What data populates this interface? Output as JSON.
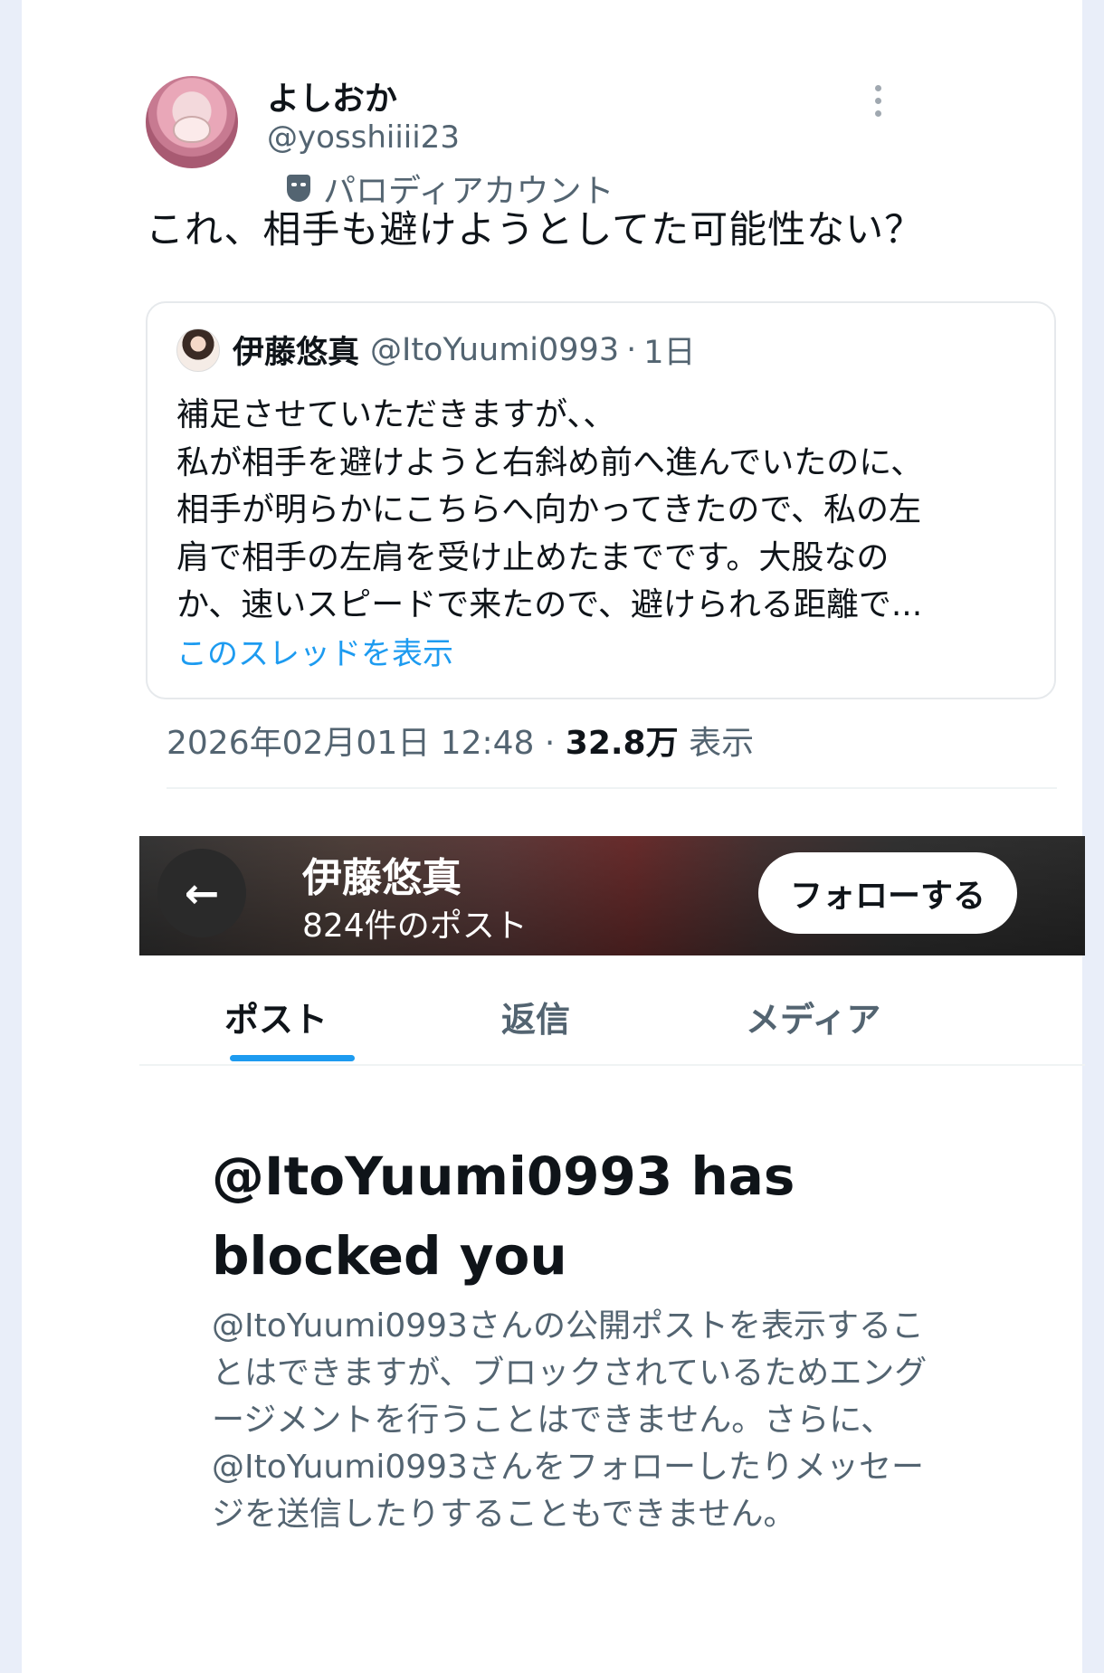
{
  "tweet": {
    "display_name": "よしおか",
    "handle": "@yosshiiii23",
    "parody_label": "パロディアカウント",
    "text": "これ、相手も避けようとしてた可能性ない？",
    "timestamp": "2026年02月01日 12:48",
    "views_count": "32.8万",
    "views_label": "表示"
  },
  "quote": {
    "name": "伊藤悠真",
    "handle": "@ItoYuumi0993",
    "separator": "·",
    "age": "1日",
    "lines": [
      "補足させていただきますが、、",
      "私が相手を避けようと右斜め前へ進んでいたのに、",
      "相手が明らかにこちらへ向かってきたので、私の左",
      "肩で相手の左肩を受け止めたまでです。大股なの",
      "か、速いスピードで来たので、避けられる距離で..."
    ],
    "show_thread": "このスレッドを表示"
  },
  "profile": {
    "back_icon": "←",
    "name": "伊藤悠真",
    "post_count": "824件のポスト",
    "follow_label": "フォローする",
    "tabs": [
      "ポスト",
      "返信",
      "メディア"
    ]
  },
  "blocked": {
    "title_line1": "@ItoYuumi0993 has",
    "title_line2": "blocked you",
    "body_lines": [
      "@ItoYuumi0993さんの公開ポストを表示するこ",
      "とはできますが、ブロックされているためエング",
      "ージメントを行うことはできません。さらに、",
      "@ItoYuumi0993さんをフォローしたりメッセー",
      "ジを送信したりすることもできません。"
    ]
  },
  "colors": {
    "accent": "#1d9bf0",
    "secondary_text": "#536471",
    "primary_text": "#0f1419"
  }
}
